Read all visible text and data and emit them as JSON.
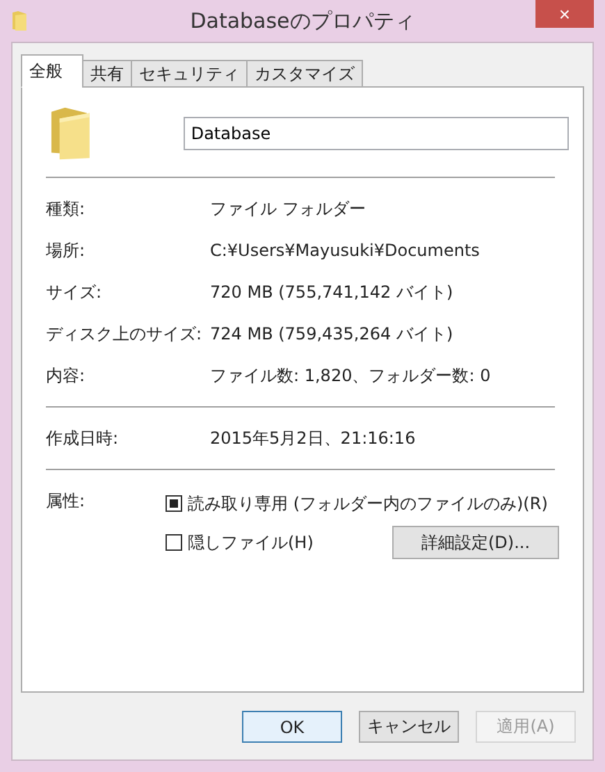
{
  "window": {
    "title": "Databaseのプロパティ",
    "close": "×"
  },
  "tabs": [
    {
      "label": "全般",
      "selected": true
    },
    {
      "label": "共有",
      "selected": false
    },
    {
      "label": "セキュリティ",
      "selected": false
    },
    {
      "label": "カスタマイズ",
      "selected": false
    }
  ],
  "name_field": {
    "value": "Database"
  },
  "sections": [
    [
      {
        "label": "種類:",
        "value": "ファイル フォルダー"
      },
      {
        "label": "場所:",
        "value": "C:¥Users¥Mayusuki¥Documents"
      },
      {
        "label": "サイズ:",
        "value": "720 MB (755,741,142 バイト)"
      },
      {
        "label": "ディスク上のサイズ:",
        "value": "724 MB (759,435,264 バイト)"
      },
      {
        "label": "内容:",
        "value": "ファイル数: 1,820、フォルダー数: 0"
      }
    ],
    [
      {
        "label": "作成日時:",
        "value": "2015年5月2日、21:16:16"
      }
    ]
  ],
  "attributes": {
    "label": "属性:",
    "checkboxes": [
      {
        "label": "読み取り専用 (フォルダー内のファイルのみ)(R)",
        "checked": false,
        "indeterminate": true
      },
      {
        "label": "隠しファイル(H)",
        "checked": false,
        "indeterminate": false
      }
    ],
    "advanced_button": "詳細設定(D)..."
  },
  "buttons": [
    {
      "label": "OK",
      "default": true,
      "disabled": false
    },
    {
      "label": "キャンセル",
      "default": false,
      "disabled": false
    },
    {
      "label": "適用(A)",
      "default": false,
      "disabled": true
    }
  ]
}
